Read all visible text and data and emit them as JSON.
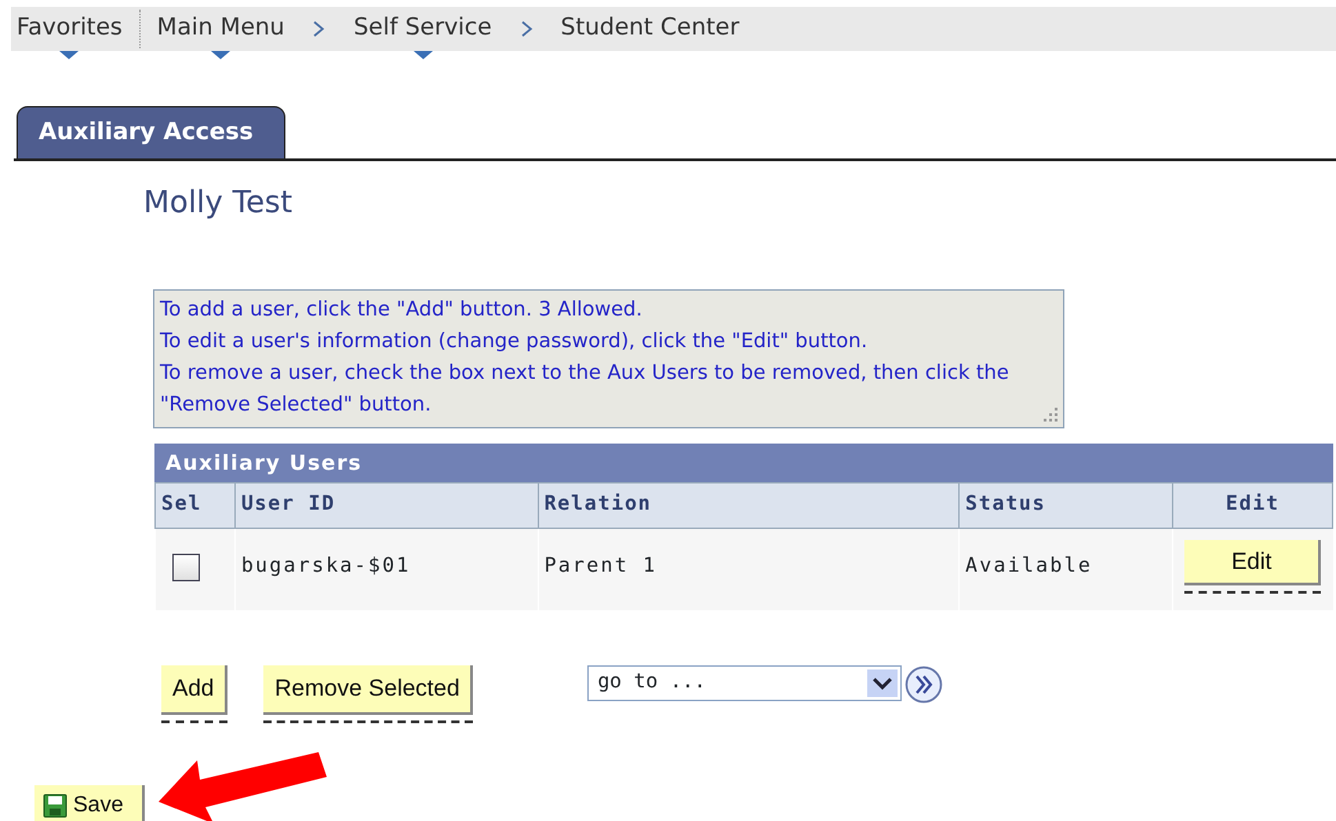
{
  "favorites": {
    "label": "Favorites",
    "dropdown": true
  },
  "breadcrumb": [
    {
      "label": "Main Menu",
      "dropdown": true
    },
    {
      "label": "Self Service",
      "dropdown": true
    },
    {
      "label": "Student Center",
      "dropdown": false
    }
  ],
  "tabs": [
    {
      "label": "Auxiliary Access",
      "selected": true
    }
  ],
  "student_name": "Molly Test",
  "instructions": [
    "To add a user, click the \"Add\" button.  3 Allowed.",
    "To edit a user's information (change password), click the \"Edit\" button.",
    "To remove a user, check the box next to the Aux Users to be removed, then click the \"Remove Selected\" button."
  ],
  "grid": {
    "title": "Auxiliary Users",
    "columns": [
      "Sel",
      "User ID",
      "Relation",
      "Status",
      "Edit"
    ],
    "rows": [
      {
        "checked": false,
        "user_id": "bugarska-$01",
        "relation": "Parent 1",
        "status": "Available",
        "edit": "Edit"
      }
    ]
  },
  "buttons": [
    "Add",
    "Remove Selected"
  ],
  "goto": {
    "value": "go to ..."
  },
  "save_button": "Save"
}
